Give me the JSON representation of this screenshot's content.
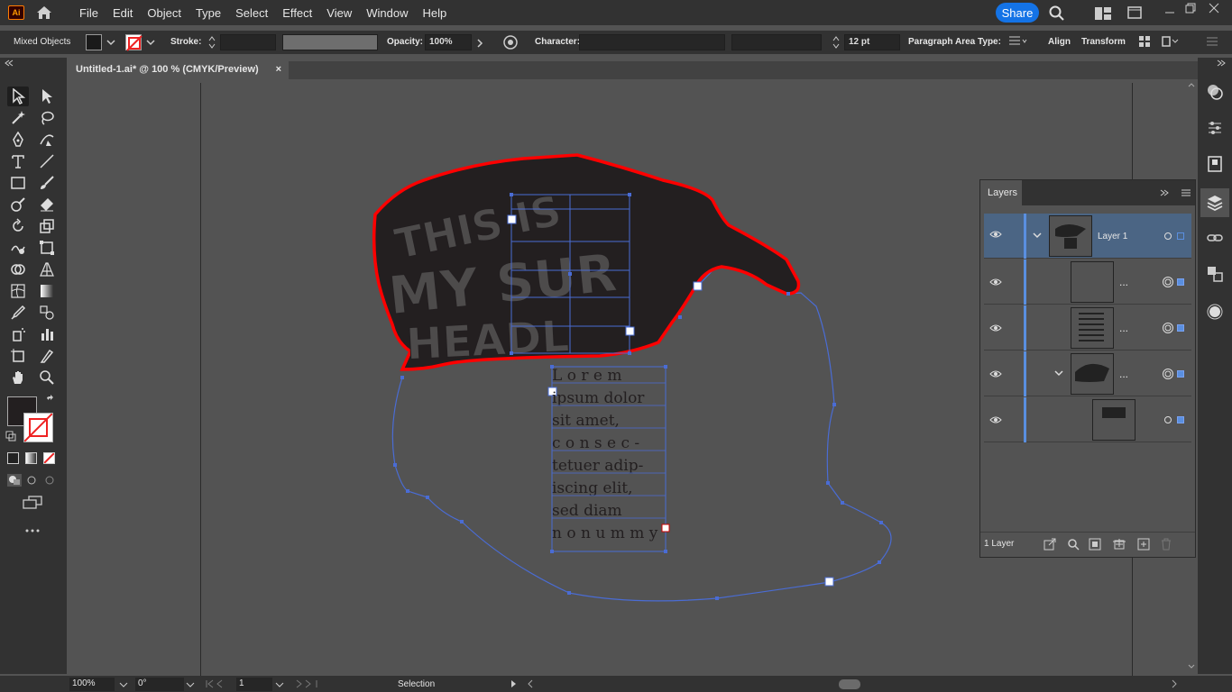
{
  "app": {
    "logo_text": "Ai"
  },
  "menu": [
    "File",
    "Edit",
    "Object",
    "Type",
    "Select",
    "Effect",
    "View",
    "Window",
    "Help"
  ],
  "share_label": "Share",
  "control": {
    "selection_label": "Mixed Objects",
    "stroke_label": "Stroke:",
    "opacity_label": "Opacity:",
    "opacity_value": "100%",
    "character_label": "Character:",
    "font_size": "12 pt",
    "paragraph_label": "Paragraph",
    "area_type_label": "Area Type:",
    "align_label": "Align",
    "transform_label": "Transform"
  },
  "document": {
    "tab_title": "Untitled-1.ai* @ 100 % (CMYK/Preview)",
    "close": "×"
  },
  "canvas_text": {
    "lines": [
      "L o r e m",
      "ipsum dolor",
      "sit     amet,",
      "c o n s e c -",
      "tetuer adip-",
      "iscing    elit,",
      "sed     diam",
      "n o n u m m y"
    ]
  },
  "layers_panel": {
    "title": "Layers",
    "rows": [
      {
        "label": "Layer 1",
        "selected": true
      },
      {
        "label": "...",
        "selected": false
      },
      {
        "label": "...",
        "selected": false
      },
      {
        "label": "...",
        "selected": false
      },
      {
        "label": "",
        "selected": false
      }
    ],
    "footer_count": "1 Layer"
  },
  "status": {
    "zoom": "100%",
    "rotate": "0°",
    "artboard": "1",
    "mode": "Selection"
  },
  "colors": {
    "accent": "#1473e6",
    "selection": "#4a6cd4",
    "highlight": "#ff0000"
  }
}
